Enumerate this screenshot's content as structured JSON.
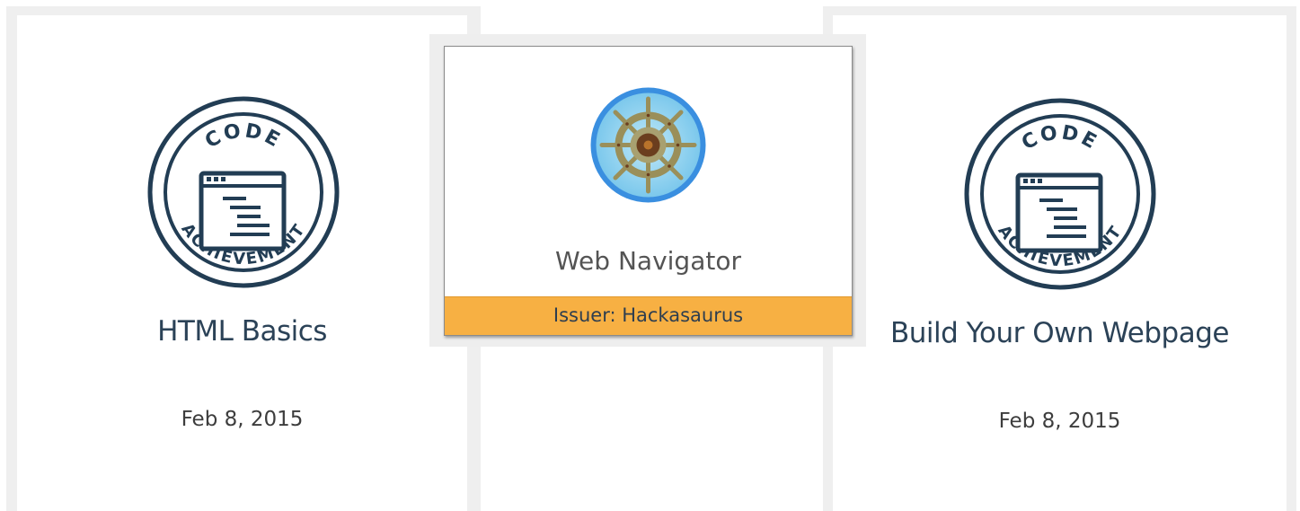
{
  "badges": [
    {
      "title": "HTML Basics",
      "date": "Feb 8, 2015",
      "emblem": {
        "icon": "code-achievement-badge-icon",
        "top_text": "CODE",
        "bottom_text": "ACHIEVEMENT",
        "color": "#223d54"
      }
    },
    {
      "title": "Web Navigator",
      "issuer_label": "Issuer: Hackasaurus",
      "emblem": {
        "icon": "ship-wheel-badge-icon"
      },
      "issuer_bar_color": "#f7b043"
    },
    {
      "title": "Build Your Own Webpage",
      "date": "Feb 8, 2015",
      "emblem": {
        "icon": "code-achievement-badge-icon",
        "top_text": "CODE",
        "bottom_text": "ACHIEVEMENT",
        "color": "#223d54"
      }
    }
  ]
}
